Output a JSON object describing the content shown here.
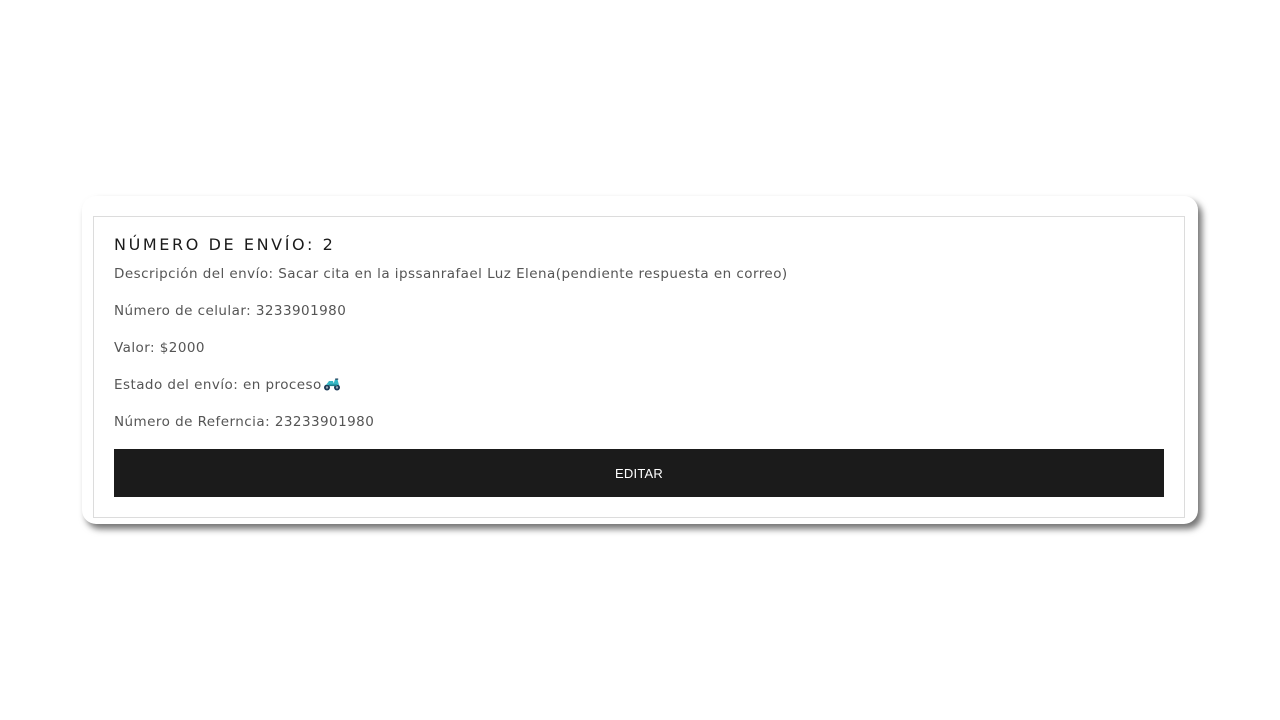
{
  "card": {
    "title": "NÚMERO DE ENVÍO: 2",
    "description": "Descripción del envío: Sacar cita en la ipssanrafael Luz Elena(pendiente respuesta en correo)",
    "phone": "Número de celular: 3233901980",
    "value": "Valor: $2000",
    "status": "Estado del envío: en proceso",
    "status_icon": "scooter-icon",
    "reference": "Número de Referncia: 23233901980",
    "edit_label": "EDITAR"
  },
  "colors": {
    "button_background": "#1b1b1b",
    "button_text": "#ffffff",
    "body_text": "#555555",
    "title_text": "#1b1b1b",
    "scooter_icon": "#35b6c4"
  }
}
